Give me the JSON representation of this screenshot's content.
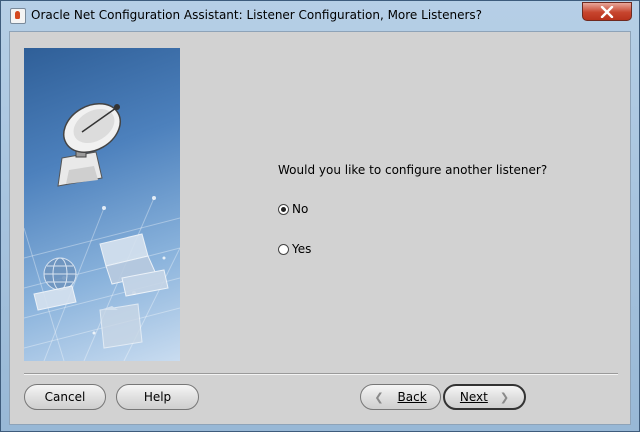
{
  "window": {
    "title": "Oracle Net Configuration Assistant: Listener Configuration, More Listeners?",
    "close_icon": "close-x-icon",
    "app_icon": "java-cup-icon"
  },
  "main": {
    "question": "Would you like to configure another listener?",
    "options": [
      {
        "label": "No",
        "selected": true
      },
      {
        "label": "Yes",
        "selected": false
      }
    ]
  },
  "buttons": {
    "cancel": "Cancel",
    "help": "Help",
    "back": "Back",
    "next": "Next"
  },
  "colors": {
    "title_bar": "#a9c4df",
    "close_button": "#c7452e",
    "dialog_bg": "#d2d2d2",
    "graphic_blue": "#4d81bd"
  }
}
